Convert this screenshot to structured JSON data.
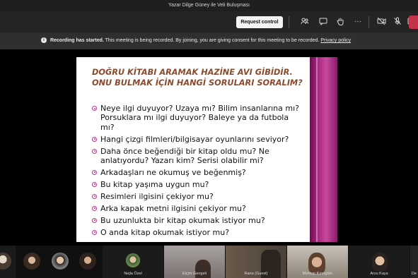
{
  "window": {
    "title": "Yazar Dilge Güney ile Veli Buluşması"
  },
  "toolbar": {
    "request_control_label": "Request control",
    "icons": [
      "people-icon",
      "chat-icon",
      "raise-hand-icon",
      "more-icon",
      "camera-off-icon",
      "mic-off-icon",
      "share-icon",
      "leave-icon"
    ]
  },
  "banner": {
    "title": "Recording has started.",
    "message": "This meeting is being recorded. By joining, you are giving consent for this meeting to be recorded.",
    "link": "Privacy policy"
  },
  "slide": {
    "title_line1": "DOĞRU KİTABI ARAMAK HAZİNE AVI GİBİDİR.",
    "title_line2": "ONU BULMAK İÇİN HANGİ SORULARI SORALIM?",
    "bullets": [
      "Neye ilgi duyuyor? Uzaya mı? Bilim insanlarına mı? Porsuklara mı ilgi duyuyor? Baleye ya da futbola mı?",
      "Hangi çizgi filmleri/bilgisayar oyunlarını seviyor?",
      "Daha önce beğendiği bir kitap oldu mu? Ne anlatıyordu? Yazarı kim? Serisi olabilir mi?",
      "Arkadaşları ne okumuş ve beğenmiş?",
      "Bu kitap yaşıma uygun mu?",
      "Resimleri ilgisini çekiyor mu?",
      "Arka kapak metni ilgisini çekiyor mu?",
      "Bu uzunlukta bir kitap okumak istiyor mu?",
      "O anda kitap okumak istiyor mu?"
    ],
    "accent_color": "#b12c88",
    "title_color": "#8b4a2c"
  },
  "participants": [
    {
      "name": ""
    },
    {
      "name": ""
    },
    {
      "name": ""
    },
    {
      "name": ""
    },
    {
      "name": "Nejla Özel"
    },
    {
      "name": "Elçim Gengeli"
    },
    {
      "name": "Rana (Guest)"
    },
    {
      "name": "Mehtap Kırıngton"
    },
    {
      "name": "Arzu Kaya"
    },
    {
      "name": "De"
    }
  ]
}
